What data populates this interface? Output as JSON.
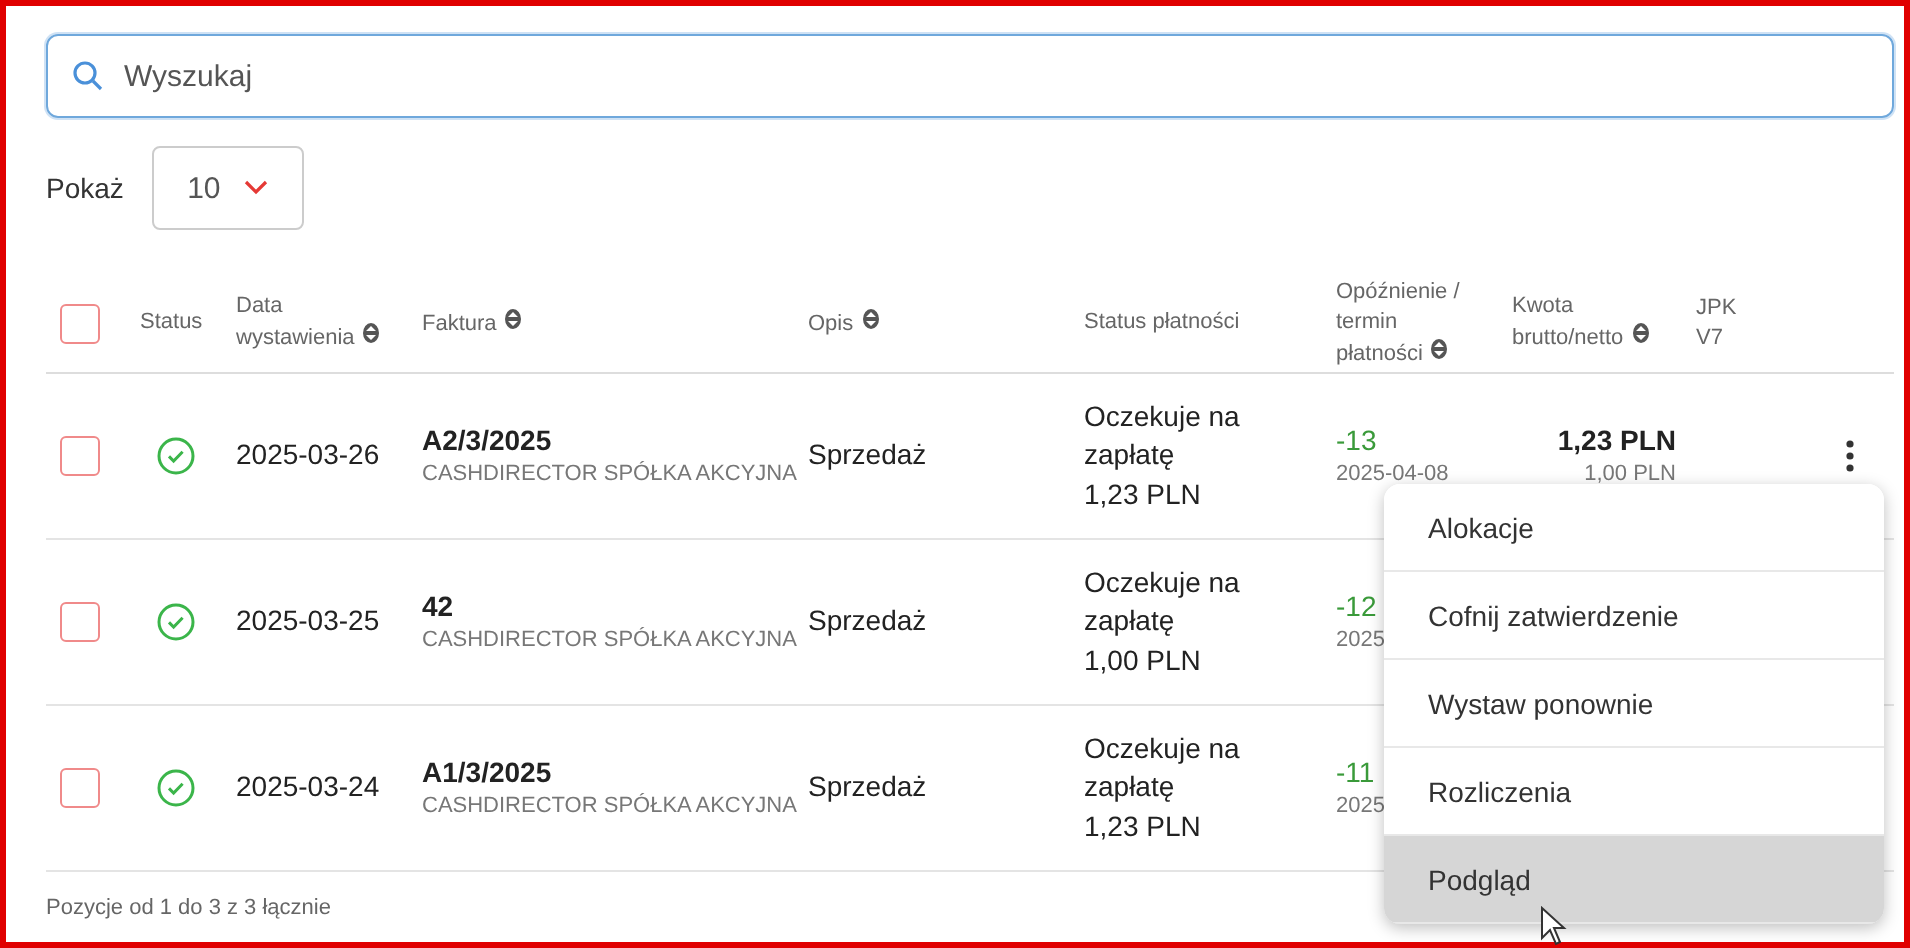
{
  "search": {
    "placeholder": "Wyszukaj"
  },
  "page_size": {
    "label": "Pokaż",
    "value": "10"
  },
  "select_all": {
    "checked": false
  },
  "table": {
    "columns": [
      {
        "label": "Status",
        "sortable": false
      },
      {
        "label": "Data wystawienia",
        "sortable": true
      },
      {
        "label": "Faktura",
        "sortable": true
      },
      {
        "label": "Opis",
        "sortable": true
      },
      {
        "label": "Status płatności",
        "sortable": false
      },
      {
        "label": "Opóźnienie / termin płatności",
        "sortable": true
      },
      {
        "label": "Kwota brutto/netto",
        "sortable": true
      },
      {
        "label": "JPK V7",
        "sortable": false
      }
    ],
    "rows": [
      {
        "checked": false,
        "kind": "ok",
        "date": "2025-03-26",
        "invoice": "A2/3/2025",
        "company": "CASHDIRECTOR SPÓŁKA AKCYJNA",
        "description": "Sprzedaż",
        "payment_status": "Oczekuje na zapłatę",
        "payment_amount": "1,23 PLN",
        "delay": "-13",
        "due_date": "2025-04-08",
        "gross": "1,23 PLN",
        "net": "1,00 PLN"
      },
      {
        "checked": false,
        "kind": "ok",
        "date": "2025-03-25",
        "invoice": "42",
        "company": "CASHDIRECTOR SPÓŁKA AKCYJNA",
        "description": "Sprzedaż",
        "payment_status": "Oczekuje na zapłatę",
        "payment_amount": "1,00 PLN",
        "delay": "-12",
        "due_date": "2025"
      },
      {
        "checked": false,
        "kind": "ok",
        "date": "2025-03-24",
        "invoice": "A1/3/2025",
        "company": "CASHDIRECTOR SPÓŁKA AKCYJNA",
        "description": "Sprzedaż",
        "payment_status": "Oczekuje na zapłatę",
        "payment_amount": "1,23 PLN",
        "delay": "-11",
        "due_date": "2025"
      }
    ],
    "footer": "Pozycje od 1 do 3 z 3 łącznie"
  },
  "context_menu": [
    {
      "label": "Alokacje",
      "selected": false
    },
    {
      "label": "Cofnij zatwierdzenie",
      "selected": false
    },
    {
      "label": "Wystaw ponownie",
      "selected": false
    },
    {
      "label": "Rozliczenia",
      "selected": false
    },
    {
      "label": "Podgląd",
      "selected": true
    }
  ]
}
